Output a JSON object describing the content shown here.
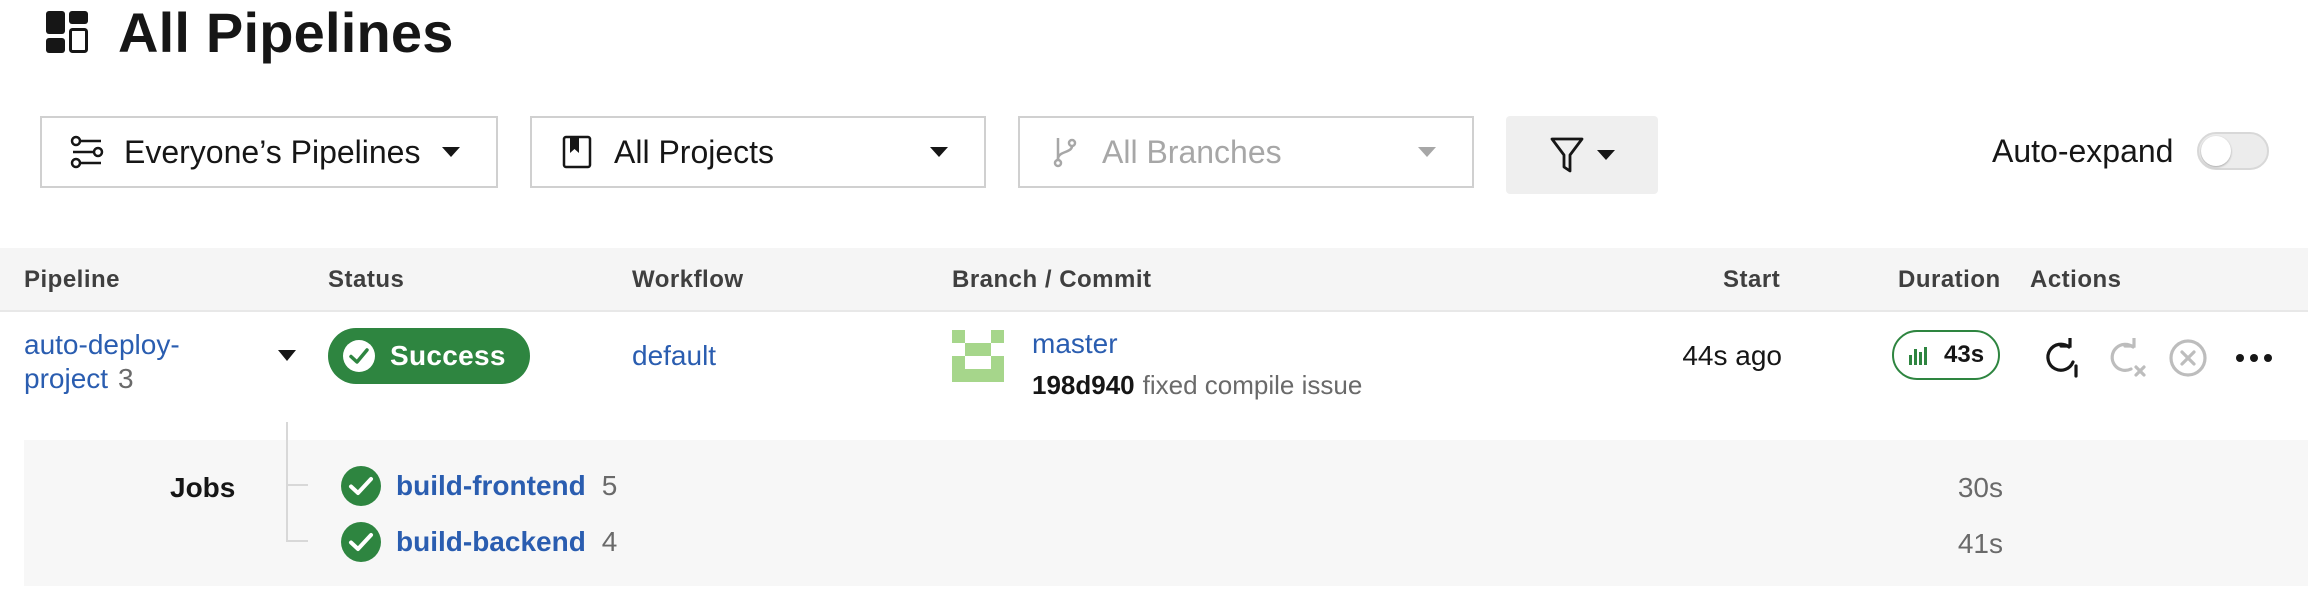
{
  "header": {
    "title": "All Pipelines",
    "icon": "dashboard-icon"
  },
  "filters": {
    "people": {
      "label": "Everyone’s Pipelines",
      "icon": "pipelines-icon"
    },
    "projects": {
      "label": "All Projects",
      "icon": "bookmark-icon"
    },
    "branches": {
      "label": "All Branches",
      "icon": "branch-icon",
      "disabled": true
    },
    "filter_button": {
      "icon": "filter-icon"
    },
    "auto_expand": {
      "label": "Auto-expand",
      "enabled": false
    }
  },
  "table": {
    "columns": {
      "pipeline": "Pipeline",
      "status": "Status",
      "workflow": "Workflow",
      "branch_commit": "Branch / Commit",
      "start": "Start",
      "duration": "Duration",
      "actions": "Actions"
    },
    "rows": [
      {
        "pipeline_name": "auto-deploy-project",
        "pipeline_number": "3",
        "status": "Success",
        "workflow": "default",
        "branch": "master",
        "commit_sha": "198d940",
        "commit_message": "fixed compile issue",
        "start": "44s ago",
        "duration": "43s",
        "jobs_label": "Jobs",
        "jobs": [
          {
            "name": "build-frontend",
            "number": "5",
            "duration": "30s"
          },
          {
            "name": "build-backend",
            "number": "4",
            "duration": "41s"
          }
        ]
      }
    ]
  },
  "colors": {
    "success": "#2e8540",
    "link": "#2a5db0",
    "header_bg": "#f5f5f5",
    "jobs_bg": "#f7f7f7"
  }
}
